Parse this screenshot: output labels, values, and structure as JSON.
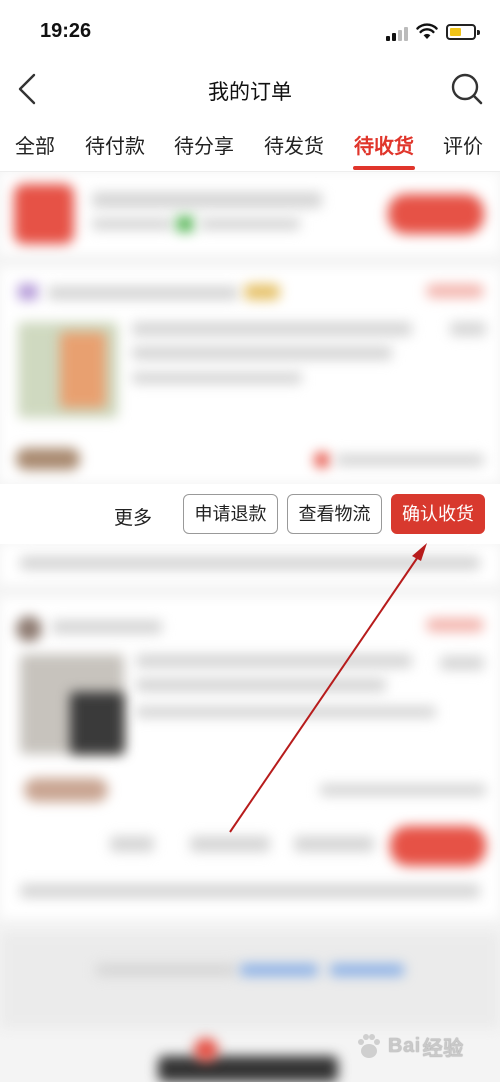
{
  "status_bar": {
    "time": "19:26"
  },
  "nav": {
    "title": "我的订单"
  },
  "tabs": [
    {
      "label": "全部",
      "active": false
    },
    {
      "label": "待付款",
      "active": false
    },
    {
      "label": "待分享",
      "active": false
    },
    {
      "label": "待发货",
      "active": false
    },
    {
      "label": "待收货",
      "active": true
    },
    {
      "label": "评价",
      "active": false
    }
  ],
  "order_actions": {
    "more": "更多",
    "refund": "申请退款",
    "logistics": "查看物流",
    "confirm_receipt": "确认收货"
  },
  "watermark": {
    "brand": "Bai",
    "brand_cn": "经验"
  },
  "colors": {
    "accent": "#e0352b",
    "confirm_button": "#d8392e",
    "annotation_arrow": "#b71c1c"
  }
}
